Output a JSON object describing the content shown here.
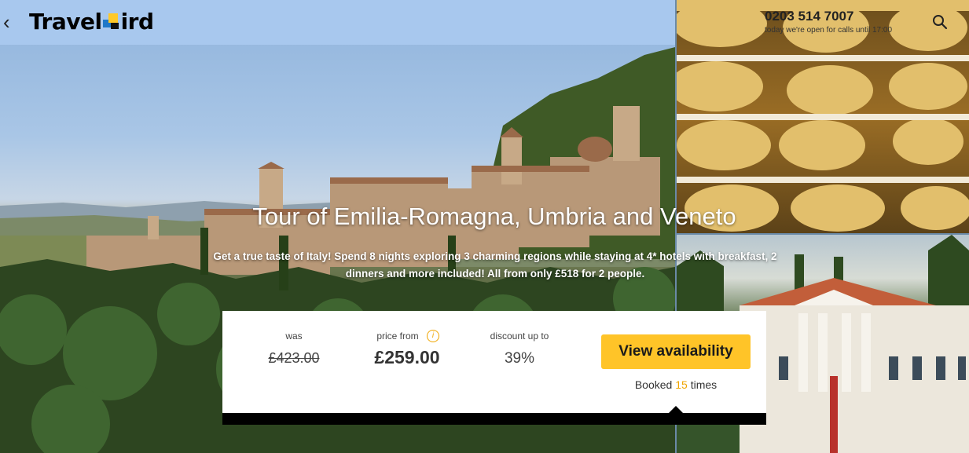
{
  "header": {
    "back_icon": "chevron-left-icon",
    "logo_text_left": "Travel",
    "logo_text_right": "ird",
    "logo_letter": "B",
    "phone": "0203 514 7007",
    "hours": "today we're open for calls until 17:00",
    "search_icon": "search-icon"
  },
  "hero": {
    "title": "Tour of Emilia-Romagna, Umbria and Veneto",
    "subtitle": "Get a true taste of Italy! Spend 8 nights exploring 3 charming regions while staying at 4* hotels with breakfast, 2 dinners and more included! All from only £518 for 2 people."
  },
  "pricing": {
    "was_label": "was",
    "was_value": "£423.00",
    "price_label": "price from",
    "price_value": "£259.00",
    "info_icon": "info-icon",
    "discount_label": "discount up to",
    "discount_value": "39%",
    "cta_label": "View availability",
    "booked_prefix": "Booked",
    "booked_count": "15",
    "booked_suffix": "times"
  },
  "colors": {
    "accent": "#ffc428",
    "accent_text": "#f0a500",
    "bar": "#000000"
  }
}
